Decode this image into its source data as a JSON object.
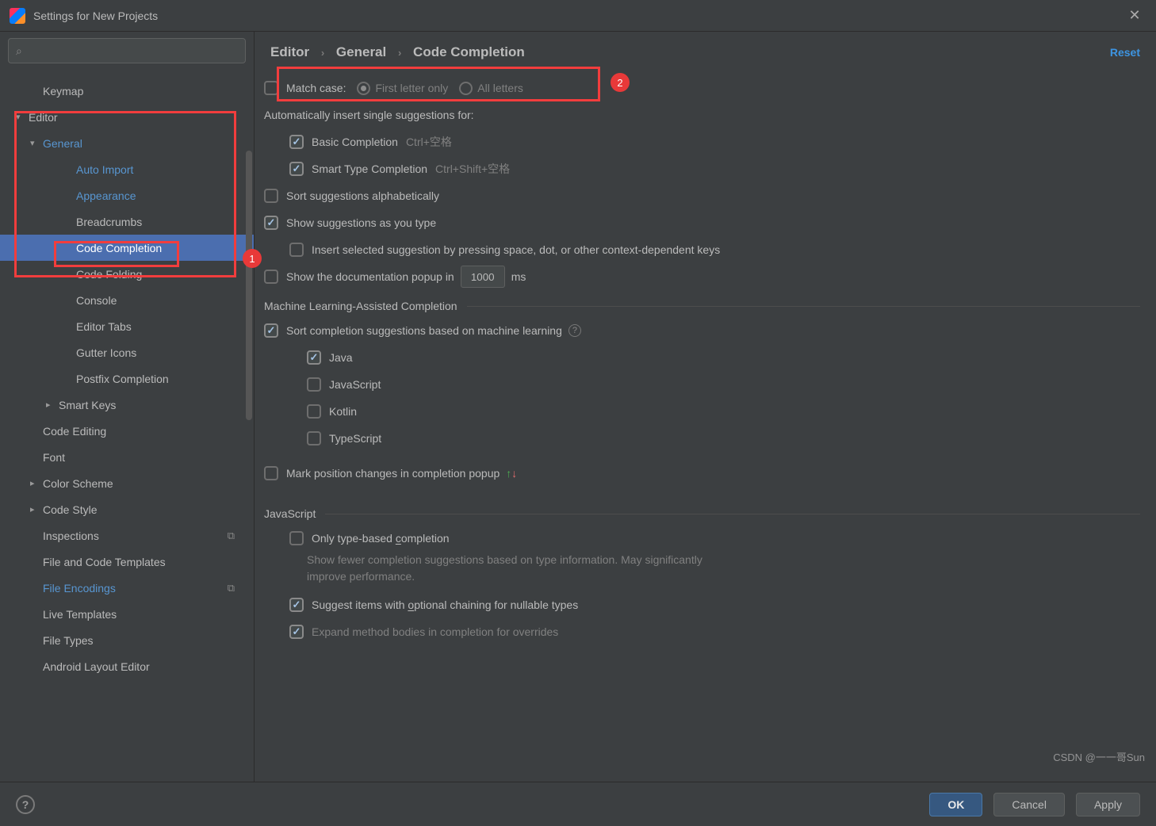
{
  "window": {
    "title": "Settings for New Projects"
  },
  "search": {
    "placeholder": ""
  },
  "sidebar": {
    "items": [
      {
        "label": "Keymap",
        "depth": 1,
        "chev": ""
      },
      {
        "label": "Editor",
        "depth": 0,
        "chev": "▾"
      },
      {
        "label": "General",
        "depth": 1,
        "chev": "▾",
        "link": true
      },
      {
        "label": "Auto Import",
        "depth": 3,
        "link": true
      },
      {
        "label": "Appearance",
        "depth": 3,
        "link": true
      },
      {
        "label": "Breadcrumbs",
        "depth": 3
      },
      {
        "label": "Code Completion",
        "depth": 3,
        "selected": true
      },
      {
        "label": "Code Folding",
        "depth": 3
      },
      {
        "label": "Console",
        "depth": 3
      },
      {
        "label": "Editor Tabs",
        "depth": 3
      },
      {
        "label": "Gutter Icons",
        "depth": 3
      },
      {
        "label": "Postfix Completion",
        "depth": 3
      },
      {
        "label": "Smart Keys",
        "depth": 2,
        "chev": "▸"
      },
      {
        "label": "Code Editing",
        "depth": 1
      },
      {
        "label": "Font",
        "depth": 1
      },
      {
        "label": "Color Scheme",
        "depth": 1,
        "chev": "▸"
      },
      {
        "label": "Code Style",
        "depth": 1,
        "chev": "▸"
      },
      {
        "label": "Inspections",
        "depth": 1,
        "copy": true
      },
      {
        "label": "File and Code Templates",
        "depth": 1
      },
      {
        "label": "File Encodings",
        "depth": 1,
        "link": true,
        "copy": true
      },
      {
        "label": "Live Templates",
        "depth": 1
      },
      {
        "label": "File Types",
        "depth": 1
      },
      {
        "label": "Android Layout Editor",
        "depth": 1
      }
    ]
  },
  "breadcrumb": {
    "a": "Editor",
    "b": "General",
    "c": "Code Completion"
  },
  "reset": "Reset",
  "match_case": {
    "label": "Match case:",
    "opt1": "First letter only",
    "opt2": "All letters"
  },
  "auto_insert_header": "Automatically insert single suggestions for:",
  "basic": {
    "label": "Basic Completion",
    "sc": "Ctrl+空格"
  },
  "smart": {
    "label": "Smart Type Completion",
    "sc": "Ctrl+Shift+空格"
  },
  "sort_alpha": "Sort suggestions alphabetically",
  "show_as_type": "Show suggestions as you type",
  "insert_keys": "Insert selected suggestion by pressing space, dot, or other context-dependent keys",
  "show_doc": {
    "pre": "Show the documentation popup in",
    "val": "1000",
    "suf": "ms"
  },
  "ml_header": "Machine Learning-Assisted Completion",
  "ml_sort": "Sort completion suggestions based on machine learning",
  "langs": {
    "java": "Java",
    "js": "JavaScript",
    "kotlin": "Kotlin",
    "ts": "TypeScript"
  },
  "mark_pos": "Mark position changes in completion popup",
  "js_header": "JavaScript",
  "only_type": {
    "label_a": "Only type-based ",
    "label_u": "c",
    "label_b": "ompletion",
    "desc": "Show fewer completion suggestions based on type information. May significantly improve performance."
  },
  "suggest_opt": {
    "a": "Suggest items with ",
    "u": "o",
    "b": "ptional chaining for nullable types"
  },
  "expand_over": "Expand method bodies in completion for overrides",
  "buttons": {
    "ok": "OK",
    "cancel": "Cancel",
    "apply": "Apply"
  },
  "badges": {
    "b1": "1",
    "b2": "2"
  },
  "watermark": "CSDN @一一哥Sun"
}
